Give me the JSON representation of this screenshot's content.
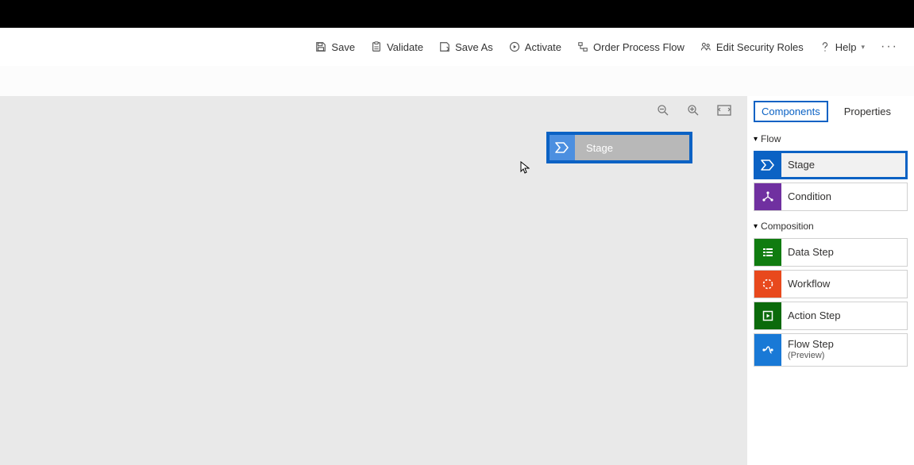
{
  "cmdbar": {
    "save": "Save",
    "validate": "Validate",
    "save_as": "Save As",
    "activate": "Activate",
    "process": "Order Process Flow",
    "security": "Edit Security Roles",
    "help": "Help"
  },
  "canvas": {
    "drag_label": "Stage"
  },
  "tabs": {
    "components": "Components",
    "properties": "Properties"
  },
  "groups": {
    "flow": "Flow",
    "composition": "Composition"
  },
  "tiles": {
    "stage": "Stage",
    "condition": "Condition",
    "datastep": "Data Step",
    "workflow": "Workflow",
    "actionstep": "Action Step",
    "flowstep": "Flow Step",
    "flowstep_sub": "(Preview)"
  }
}
